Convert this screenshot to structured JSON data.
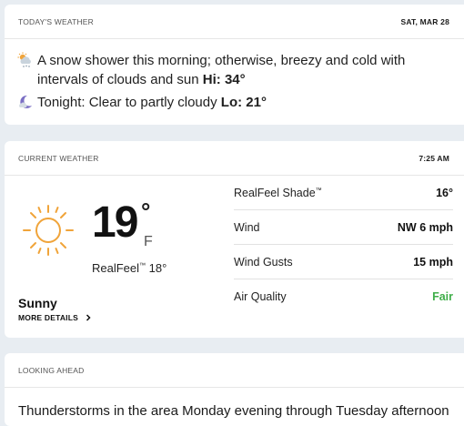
{
  "today": {
    "header": "TODAY'S WEATHER",
    "date": "SAT, MAR 28",
    "day_text": "A snow shower this morning; otherwise, breezy and cold with intervals of clouds and sun",
    "hi_label": "Hi: 34°",
    "night_text": "Tonight: Clear to partly cloudy",
    "lo_label": "Lo: 21°",
    "day_icon": "snow-sun-cloud-icon",
    "night_icon": "moon-cloud-icon"
  },
  "current": {
    "header": "CURRENT WEATHER",
    "time": "7:25 AM",
    "temp": "19",
    "deg": "°",
    "unit": "F",
    "realfeel_label": "RealFeel",
    "realfeel_tm": "™",
    "realfeel_value": "18°",
    "phrase": "Sunny",
    "more_details": "MORE DETAILS",
    "icon": "sun-icon",
    "details": [
      {
        "label": "RealFeel Shade",
        "tm": "™",
        "value": "16°"
      },
      {
        "label": "Wind",
        "value": "NW 6 mph"
      },
      {
        "label": "Wind Gusts",
        "value": "15 mph"
      },
      {
        "label": "Air Quality",
        "value": "Fair",
        "value_color": "#3fae49"
      }
    ]
  },
  "ahead": {
    "header": "LOOKING AHEAD",
    "text": "Thunderstorms in the area Monday evening through Tuesday afternoon"
  },
  "colors": {
    "sun": "#f0a43a",
    "fair": "#3fae49",
    "background": "#e8edf2"
  }
}
